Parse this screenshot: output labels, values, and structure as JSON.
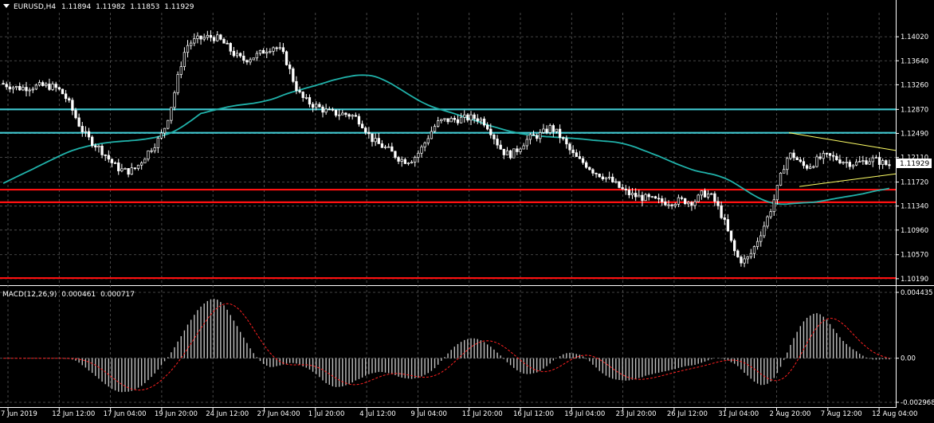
{
  "header": {
    "symbol": "EURUSD,H4",
    "open": "1.11894",
    "high": "1.11982",
    "low": "1.11853",
    "close": "1.11929"
  },
  "price_axis": [
    "1.14020",
    "1.13640",
    "1.13260",
    "1.12870",
    "1.12490",
    "1.12110",
    "1.11720",
    "1.11340",
    "1.10960",
    "1.10570",
    "1.10190"
  ],
  "current_price": "1.11929",
  "macd_header": {
    "label": "MACD(12,26,9)",
    "main": "0.000461",
    "signal": "0.000717"
  },
  "macd_axis": [
    "0.004435",
    "0.00",
    "-0.002968"
  ],
  "time_axis": [
    "7 Jun 2019",
    "12 Jun 12:00",
    "17 Jun 04:00",
    "19 Jun 20:00",
    "24 Jun 12:00",
    "27 Jun 04:00",
    "1 Jul 20:00",
    "4 Jul 12:00",
    "9 Jul 04:00",
    "11 Jul 20:00",
    "16 Jul 12:00",
    "19 Jul 04:00",
    "23 Jul 20:00",
    "26 Jul 12:00",
    "31 Jul 04:00",
    "2 Aug 20:00",
    "7 Aug 12:00",
    "12 Aug 04:00"
  ],
  "colors": {
    "background": "#000000",
    "grid": "#5a5a5a",
    "bull_candle": "#ffffff",
    "bear_candle": "#ffffff",
    "moving_average": "#20b2aa",
    "horizontal_cyan": "#40c8d0",
    "horizontal_red": "#ff1010",
    "triangle": "#ffff66",
    "macd_histogram": "#c0c0c0",
    "macd_signal": "#ff2020"
  },
  "chart_data": {
    "type": "line",
    "title": "EURUSD,H4",
    "description_note": "",
    "x": [
      "7 Jun 2019",
      "12 Jun 12:00",
      "17 Jun 04:00",
      "19 Jun 20:00",
      "24 Jun 12:00",
      "27 Jun 04:00",
      "1 Jul 20:00",
      "4 Jul 12:00",
      "9 Jul 04:00",
      "11 Jul 20:00",
      "16 Jul 12:00",
      "19 Jul 04:00",
      "23 Jul 20:00",
      "26 Jul 12:00",
      "31 Jul 04:00",
      "2 Aug 20:00",
      "7 Aug 12:00",
      "12 Aug 04:00"
    ],
    "series": [
      {
        "name": "EURUSD,H4",
        "values": [
          1.1335,
          1.13,
          1.1205,
          1.122,
          1.1405,
          1.137,
          1.1285,
          1.128,
          1.121,
          1.127,
          1.125,
          1.123,
          1.115,
          1.1155,
          1.1045,
          1.12,
          1.12,
          1.1193
        ]
      }
    ],
    "ylim": [
      1.101,
      1.144
    ],
    "horizontal_levels": {
      "cyan": [
        1.1287,
        1.125
      ],
      "red": [
        1.116,
        1.114,
        1.102
      ]
    },
    "macd": {
      "label": "MACD(12,26,9)",
      "main": 0.000461,
      "signal": 0.000717,
      "ylim": [
        -0.002968,
        0.004435
      ]
    },
    "xlabel": "",
    "ylabel": "",
    "grid": true
  }
}
